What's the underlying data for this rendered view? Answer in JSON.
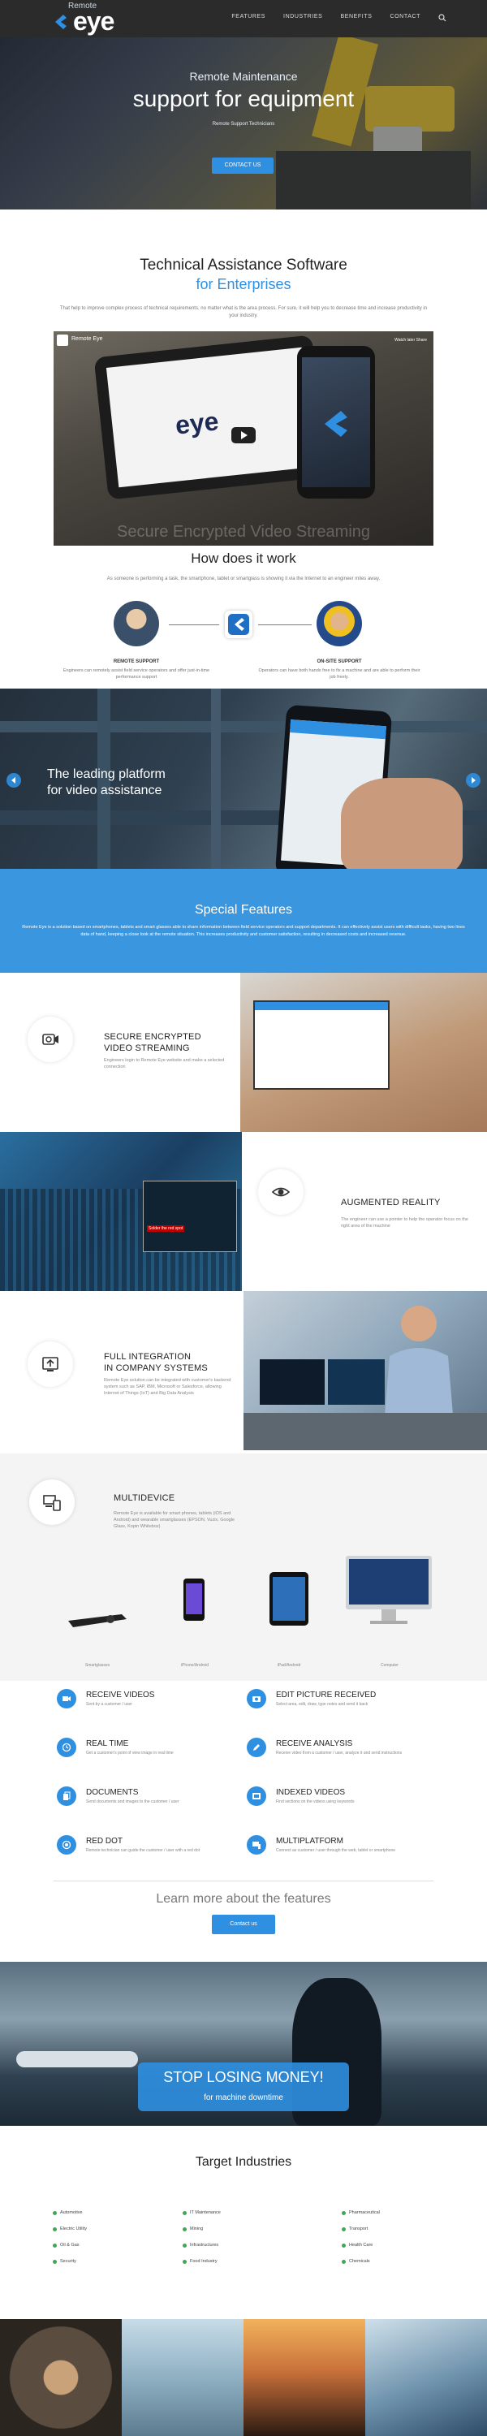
{
  "nav": {
    "logo_small": "Remote",
    "logo_big": "eye",
    "items": [
      "FEATURES",
      "INDUSTRIES",
      "BENEFITS",
      "CONTACT"
    ]
  },
  "hero": {
    "line1": "Remote Maintenance",
    "line2": "support for equipment",
    "line3": "Remote Support Technicians",
    "button": "CONTACT US"
  },
  "tech": {
    "title": "Technical Assistance Software",
    "subtitle": "for Enterprises",
    "desc": "That help to improve complex process of technical requirements, no matter what is the area process. For sure, it will help you to decrease time and increase productivity in your industry."
  },
  "video": {
    "title": "Remote Eye",
    "right": "Watch later   Share",
    "tablet_logo": "eye",
    "caption": "Secure Encrypted Video Streaming"
  },
  "how": {
    "title": "How does it work",
    "desc": "As someone is performing a task, the smartphone, tablet or smartglass is showing it via the Internet to an engineer miles away.",
    "left_title": "REMOTE SUPPORT",
    "left_desc": "Engineers can remotely assist field service operators and offer just-in-time performance support",
    "right_title": "ON-SITE SUPPORT",
    "right_desc": "Operators can have both hands free to fix a machine and are able to perform their job freely."
  },
  "platform": {
    "line1": "The leading platform",
    "line2": "for video assistance"
  },
  "special": {
    "title": "Special Features",
    "desc": "Remote Eye is a solution based on smartphones, tablets and smart glasses able to share information between field service operators and support departments. It can effectively assist users with difficult tasks, having two lines data of hand, keeping a close look at the remote situation. This increases productivity and customer satisfaction, resulting in decreased costs and increased revenue."
  },
  "features": [
    {
      "title1": "SECURE ENCRYPTED",
      "title2": "VIDEO STREAMING",
      "desc": "Engineers login to Remote Eye website and make a selected connection"
    },
    {
      "title1": "AUGMENTED REALITY",
      "title2": "",
      "desc": "The engineer can use a pointer to help the operator focus on the right area of the machine"
    },
    {
      "title1": "FULL INTEGRATION",
      "title2": "IN COMPANY SYSTEMS",
      "desc": "Remote Eye solution can be integrated with customer's backend system such as SAP, IBM, Microsoft or Salesforce, allowing Internet of Things (IoT) and Big Data Analysis"
    },
    {
      "title1": "MULTIDEVICE",
      "title2": "",
      "desc": "Remote Eye is available for smart phones, tablets (iOS and Android) and wearable smartglasses (EPSON, Vuzix, Google Glass, Kopin Whitebox)"
    }
  ],
  "devices": [
    "Smartglasses",
    "iPhone/Android",
    "iPad/Android",
    "Computer"
  ],
  "list": [
    {
      "title": "RECEIVE VIDEOS",
      "desc": "Sent by a customer / user"
    },
    {
      "title": "EDIT PICTURE RECEIVED",
      "desc": "Select area, edit, draw, type notes and send it back"
    },
    {
      "title": "REAL TIME",
      "desc": "Get a customer's point of view image in real time"
    },
    {
      "title": "RECEIVE ANALYSIS",
      "desc": "Receive video from a customer / user, analyze it and send instructions"
    },
    {
      "title": "DOCUMENTS",
      "desc": "Send documents and images to the customer / user"
    },
    {
      "title": "INDEXED VIDEOS",
      "desc": "Find sections on the videos using keywords"
    },
    {
      "title": "RED DOT",
      "desc": "Remote technician can guide the customer / user with a red dot"
    },
    {
      "title": "MULTIPLATFORM",
      "desc": "Connect as customer / user through the web, tablet or smartphone"
    }
  ],
  "learn": {
    "title": "Learn more about the features",
    "button": "Contact us"
  },
  "stop": {
    "line1": "STOP LOSING MONEY!",
    "line2": "for machine downtime"
  },
  "industries": {
    "title": "Target Industries",
    "col1": [
      "Automotive",
      "Electric Utility",
      "Oil & Gas",
      "Security"
    ],
    "col2": [
      "IT Maintenance",
      "Mining",
      "Infrastructures",
      "Food Industry"
    ],
    "col3": [
      "Pharmaceutical",
      "Transport",
      "Health Care",
      "Chemicals"
    ]
  },
  "colors": {
    "accent": "#2f8fe0",
    "nav_bg": "#2b2b2b",
    "special_bg": "#3a96de",
    "bullet": "#3aaa55"
  }
}
